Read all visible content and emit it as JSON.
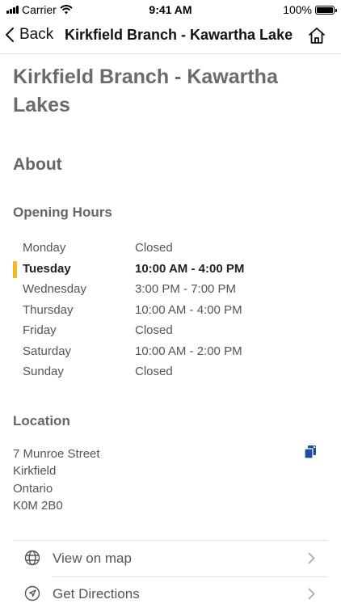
{
  "status_bar": {
    "carrier": "Carrier",
    "time": "9:41 AM",
    "battery": "100%"
  },
  "nav": {
    "back_label": "Back",
    "title": "Kirkfield Branch - Kawartha Lake"
  },
  "page": {
    "title": "Kirkfield Branch - Kawartha Lakes",
    "about_heading": "About",
    "hours_heading": "Opening Hours",
    "hours": [
      {
        "day": "Monday",
        "time": "Closed"
      },
      {
        "day": "Tuesday",
        "time": "10:00 AM - 4:00 PM"
      },
      {
        "day": "Wednesday",
        "time": "3:00 PM - 7:00 PM"
      },
      {
        "day": "Thursday",
        "time": "10:00 AM - 4:00 PM"
      },
      {
        "day": "Friday",
        "time": "Closed"
      },
      {
        "day": "Saturday",
        "time": "10:00 AM - 2:00 PM"
      },
      {
        "day": "Sunday",
        "time": "Closed"
      }
    ],
    "location_heading": "Location",
    "address": [
      "7 Munroe Street",
      "Kirkfield",
      "Ontario",
      "K0M 2B0"
    ]
  },
  "actions": {
    "view_on_map": "View on map",
    "get_directions": "Get Directions"
  },
  "colors": {
    "today_marker": "#f5b91c",
    "copy_icon": "#1f4e9c"
  }
}
